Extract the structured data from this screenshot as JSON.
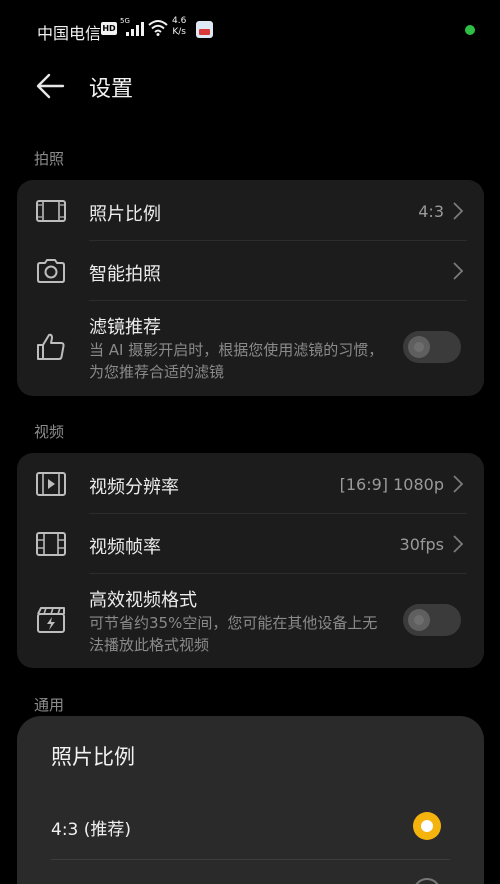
{
  "status_bar": {
    "carrier": "中国电信",
    "hd": "HD",
    "network": "5G",
    "speed_value": "4.6",
    "speed_unit": "K/s"
  },
  "header": {
    "title": "设置"
  },
  "sections": {
    "photo": {
      "label": "拍照",
      "aspect_ratio": {
        "title": "照片比例",
        "value": "4:3"
      },
      "smart_capture": {
        "title": "智能拍照"
      },
      "filter_recommend": {
        "title": "滤镜推荐",
        "subtitle": "当 AI 摄影开启时，根据您使用滤镜的习惯，为您推荐合适的滤镜",
        "enabled": false
      }
    },
    "video": {
      "label": "视频",
      "resolution": {
        "title": "视频分辨率",
        "value": "[16:9] 1080p"
      },
      "frame_rate": {
        "title": "视频帧率",
        "value": "30fps"
      },
      "efficient_format": {
        "title": "高效视频格式",
        "subtitle": "可节省约35%空间，您可能在其他设备上无法播放此格式视频",
        "enabled": false
      }
    },
    "general": {
      "label": "通用"
    }
  },
  "sheet": {
    "title": "照片比例",
    "options": [
      {
        "label": "4:3 (推荐)",
        "selected": true
      }
    ]
  },
  "colors": {
    "accent": "#f5b40d",
    "card": "#1c1c1c",
    "sheet": "#2a2a2a",
    "status_dot": "#2fbf47"
  }
}
